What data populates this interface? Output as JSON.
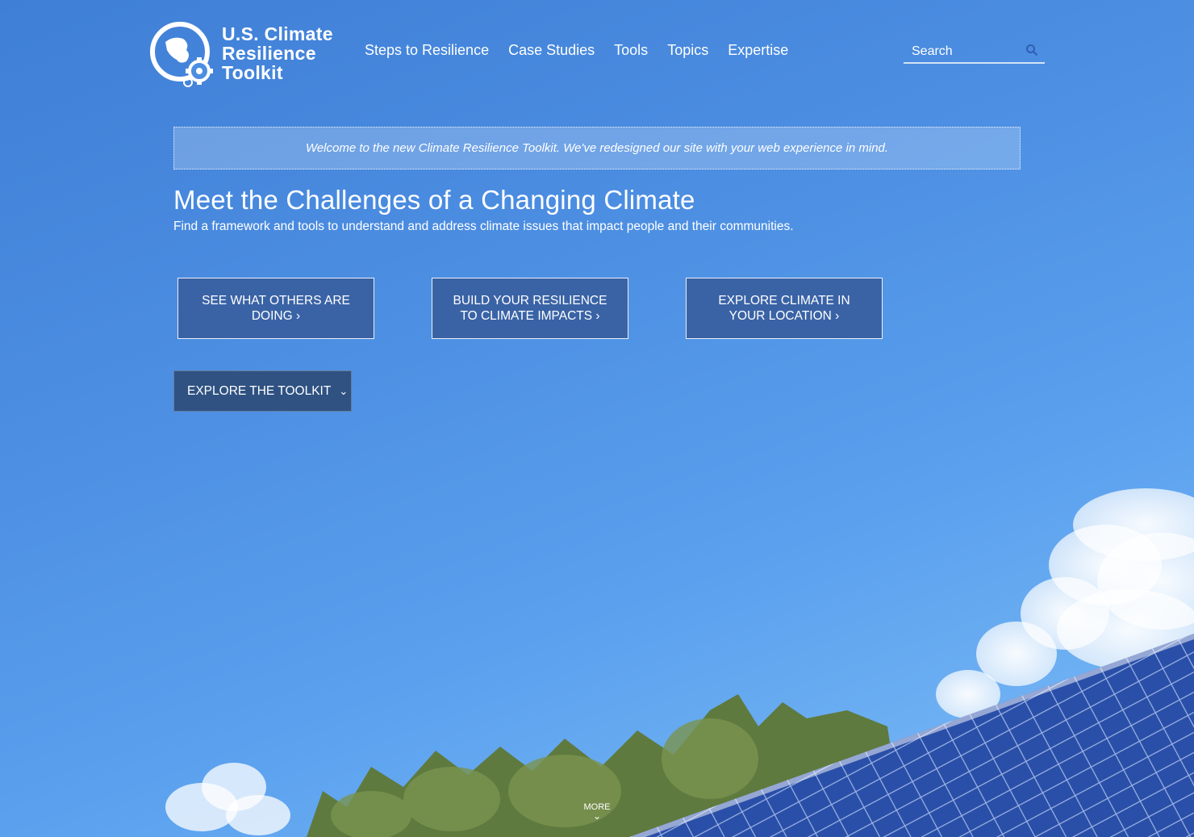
{
  "logo": {
    "line1": "U.S. Climate",
    "line2": "Resilience",
    "line3": "Toolkit",
    "icon": "globe-gear-icon"
  },
  "nav": {
    "items": [
      {
        "label": "Steps to Resilience"
      },
      {
        "label": "Case Studies"
      },
      {
        "label": "Tools"
      },
      {
        "label": "Topics"
      },
      {
        "label": "Expertise"
      }
    ]
  },
  "search": {
    "placeholder": "Search",
    "icon": "search-icon"
  },
  "banner": {
    "text": "Welcome to the new Climate Resilience Toolkit. We've redesigned our site with your web experience in mind."
  },
  "hero": {
    "title": "Meet the Challenges of a Changing Climate",
    "subtitle": "Find a framework and tools to understand and address climate issues that impact people and their communities."
  },
  "cta": [
    {
      "label": "SEE WHAT OTHERS ARE DOING ›"
    },
    {
      "label": "BUILD YOUR RESILIENCE TO CLIMATE IMPACTS ›"
    },
    {
      "label": "EXPLORE CLIMATE IN YOUR LOCATION ›"
    }
  ],
  "explore": {
    "label": "EXPLORE THE TOOLKIT",
    "icon": "chevron-down-icon"
  },
  "more": {
    "label": "MORE",
    "icon": "chevron-down-icon"
  },
  "colors": {
    "sky": "#4c8ee2",
    "cta_bg": "#3a63a6",
    "explore_bg": "#2f5282",
    "text": "#ffffff"
  }
}
